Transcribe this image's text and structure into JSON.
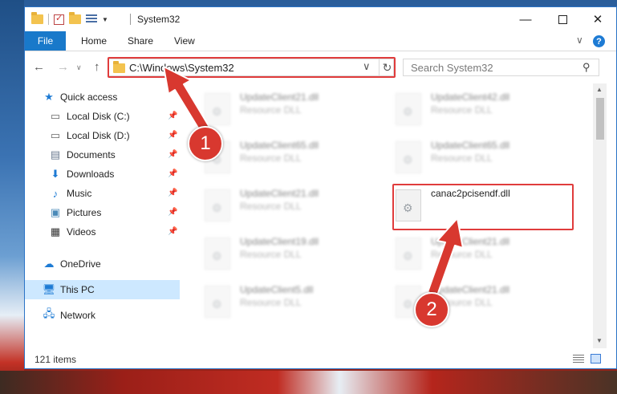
{
  "window": {
    "title": "System32",
    "controls": {
      "minimize": "—",
      "maximize": "",
      "close": "✕"
    }
  },
  "ribbon": {
    "file": "File",
    "tabs": [
      "Home",
      "Share",
      "View"
    ],
    "expand": "∨",
    "help": "?"
  },
  "navbar": {
    "back": "←",
    "forward": "→",
    "up": "↑",
    "recent": "∨",
    "address": "C:\\Windows\\System32",
    "address_dropdown": "∨",
    "refresh": "↻",
    "search_placeholder": "Search System32",
    "search_icon": "search-icon"
  },
  "sidebar": {
    "items": [
      {
        "label": "Quick access",
        "icon": "star-icon"
      },
      {
        "label": "Local Disk (C:)",
        "icon": "drive-icon",
        "pinned": true
      },
      {
        "label": "Local Disk (D:)",
        "icon": "drive-icon",
        "pinned": true
      },
      {
        "label": "Documents",
        "icon": "documents-icon",
        "pinned": true
      },
      {
        "label": "Downloads",
        "icon": "downloads-icon",
        "pinned": true
      },
      {
        "label": "Music",
        "icon": "music-icon",
        "pinned": true
      },
      {
        "label": "Pictures",
        "icon": "pictures-icon",
        "pinned": true
      },
      {
        "label": "Videos",
        "icon": "videos-icon",
        "pinned": true
      },
      {
        "label": "OneDrive",
        "icon": "cloud-icon"
      },
      {
        "label": "This PC",
        "icon": "computer-icon",
        "selected": true
      },
      {
        "label": "Network",
        "icon": "network-icon"
      }
    ]
  },
  "files": [
    {
      "name": "UpdateClient21.dll",
      "type": "Resource DLL"
    },
    {
      "name": "UpdateClient42.dll",
      "type": "Resource DLL"
    },
    {
      "name": "UpdateClient65.dll",
      "type": "Resource DLL"
    },
    {
      "name": "UpdateClient65.dll",
      "type": "Resource DLL"
    },
    {
      "name": "UpdateClient21.dll",
      "type": "Resource DLL"
    },
    {
      "name": "canac2pcisendf.dll",
      "type": ""
    },
    {
      "name": "UpdateClient19.dll",
      "type": "Resource DLL"
    },
    {
      "name": "UpdateClient21.dll",
      "type": "Resource DLL"
    },
    {
      "name": "UpdateClient5.dll",
      "type": "Resource DLL"
    },
    {
      "name": "UpdateClient21.dll",
      "type": "Resource DLL"
    }
  ],
  "status": {
    "items_count": "121 items"
  },
  "annotations": {
    "step1": "1",
    "step2": "2",
    "color": "#d8382f"
  }
}
